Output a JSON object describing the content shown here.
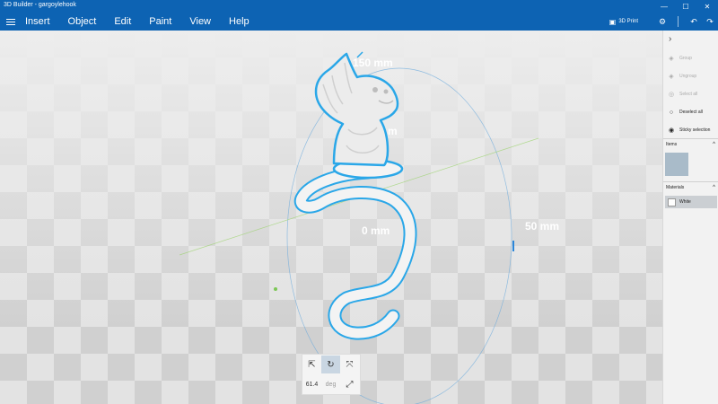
{
  "window": {
    "title": "3D Builder - gargoylehook",
    "minimize": "—",
    "maximize": "☐",
    "close": "✕"
  },
  "menubar": {
    "items": [
      "Insert",
      "Object",
      "Edit",
      "Paint",
      "View",
      "Help"
    ],
    "print_label": "3D Print",
    "undo": "↶",
    "redo": "↷"
  },
  "viewport": {
    "labels": {
      "top": "150 mm",
      "center": "0 mm",
      "right": "50 mm",
      "mid": "m"
    },
    "accent_color": "#2aa7e8"
  },
  "bottom_toolbar": {
    "rotation_value": "61.4",
    "rotation_unit": "deg"
  },
  "panel": {
    "actions": [
      {
        "label": "Group",
        "enabled": false
      },
      {
        "label": "Ungroup",
        "enabled": false
      },
      {
        "label": "Select all",
        "enabled": false
      },
      {
        "label": "Deselect all",
        "enabled": true
      },
      {
        "label": "Sticky selection",
        "enabled": true
      }
    ],
    "items_header": "Items",
    "materials_header": "Materials",
    "material_name": "White"
  }
}
